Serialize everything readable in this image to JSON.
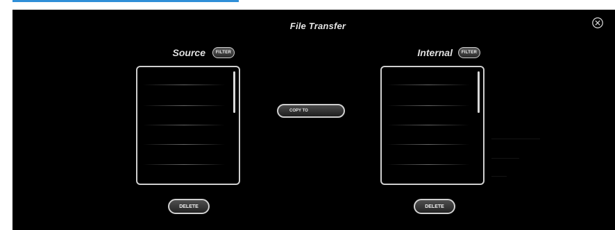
{
  "window": {
    "title": "File Transfer",
    "close_icon": "close-circle-icon"
  },
  "source": {
    "label": "Source",
    "filter_label": "FILTER",
    "delete_label": "DELETE"
  },
  "internal": {
    "label": "Internal",
    "filter_label": "FILTER",
    "delete_label": "DELETE"
  },
  "transfer": {
    "copy_label": "COPY TO"
  },
  "colors": {
    "background": "#000000",
    "border": "#cfcfcf",
    "accent": "#2f8fd8"
  }
}
